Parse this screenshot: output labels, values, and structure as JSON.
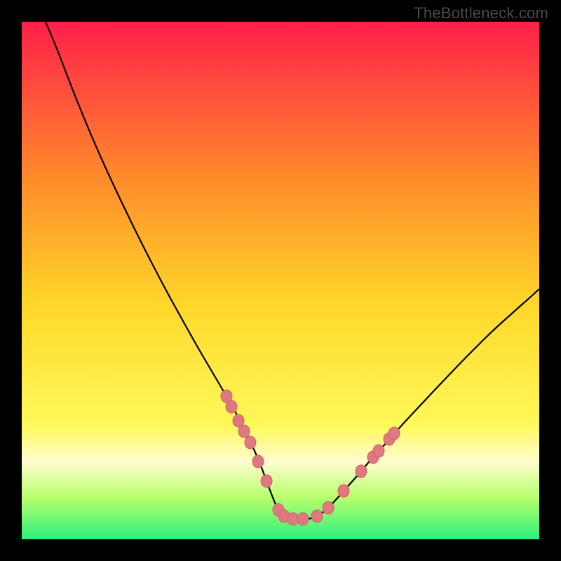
{
  "watermark": "TheBottleneck.com",
  "colors": {
    "background_black": "#000000",
    "gradient_top": "#ff1f4a",
    "gradient_mid1": "#ff8a2a",
    "gradient_mid2": "#ffd82a",
    "gradient_mid3": "#fff95a",
    "gradient_band_whiteyellow": "#fffcd0",
    "gradient_green1": "#b7ff6b",
    "gradient_green2": "#2cf07e",
    "curve": "#000000",
    "dot_fill": "#e07880",
    "dot_stroke": "#d06068"
  },
  "chart_data": {
    "type": "line",
    "title": "",
    "xlabel": "",
    "ylabel": "",
    "xlim": [
      31,
      769
    ],
    "ylim": [
      31,
      769
    ],
    "curve_points": [
      [
        65,
        31
      ],
      [
        80,
        66
      ],
      [
        100,
        119
      ],
      [
        120,
        169
      ],
      [
        140,
        216
      ],
      [
        160,
        260
      ],
      [
        180,
        302
      ],
      [
        200,
        343
      ],
      [
        220,
        382
      ],
      [
        240,
        420
      ],
      [
        260,
        456
      ],
      [
        280,
        492
      ],
      [
        300,
        526
      ],
      [
        320,
        560
      ],
      [
        335,
        586
      ],
      [
        350,
        614
      ],
      [
        360,
        636
      ],
      [
        370,
        659
      ],
      [
        378,
        680
      ],
      [
        386,
        702
      ],
      [
        394,
        722
      ],
      [
        400,
        732
      ],
      [
        406,
        738
      ],
      [
        412,
        740
      ],
      [
        420,
        740
      ],
      [
        430,
        740
      ],
      [
        440,
        740
      ],
      [
        448,
        738
      ],
      [
        456,
        734
      ],
      [
        466,
        726
      ],
      [
        478,
        714
      ],
      [
        492,
        698
      ],
      [
        508,
        680
      ],
      [
        520,
        666
      ],
      [
        530,
        654
      ],
      [
        545,
        638
      ],
      [
        560,
        621
      ],
      [
        575,
        604
      ],
      [
        590,
        588
      ],
      [
        605,
        572
      ],
      [
        620,
        556
      ],
      [
        640,
        535
      ],
      [
        660,
        514
      ],
      [
        680,
        494
      ],
      [
        700,
        474
      ],
      [
        720,
        456
      ],
      [
        740,
        438
      ],
      [
        755,
        425
      ],
      [
        769,
        412
      ]
    ],
    "dots": [
      [
        323,
        565
      ],
      [
        330,
        580
      ],
      [
        340,
        600
      ],
      [
        348,
        615
      ],
      [
        357,
        631
      ],
      [
        368,
        658
      ],
      [
        380,
        686
      ],
      [
        397,
        727
      ],
      [
        405,
        736
      ],
      [
        418,
        740
      ],
      [
        432,
        740
      ],
      [
        452,
        736
      ],
      [
        468,
        724
      ],
      [
        490,
        700
      ],
      [
        515,
        672
      ],
      [
        532,
        652
      ],
      [
        540,
        643
      ],
      [
        555,
        626
      ],
      [
        562,
        618
      ]
    ]
  }
}
